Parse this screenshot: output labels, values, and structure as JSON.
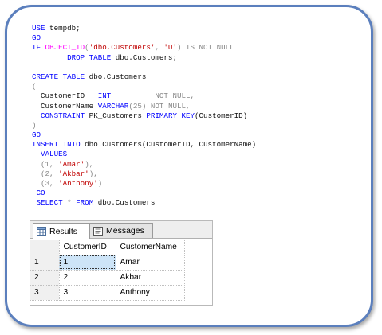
{
  "code": {
    "lines": [
      [
        {
          "t": "USE",
          "c": "kw"
        },
        {
          "t": " tempdb;",
          "c": ""
        }
      ],
      [
        {
          "t": "GO",
          "c": "kw"
        }
      ],
      [
        {
          "t": "IF",
          "c": "kw"
        },
        {
          "t": " ",
          "c": ""
        },
        {
          "t": "OBJECT_ID",
          "c": "fn"
        },
        {
          "t": "(",
          "c": "gray"
        },
        {
          "t": "'dbo.Customers'",
          "c": "str"
        },
        {
          "t": ", ",
          "c": "gray"
        },
        {
          "t": "'U'",
          "c": "str"
        },
        {
          "t": ") ",
          "c": "gray"
        },
        {
          "t": "IS NOT NULL",
          "c": "gray"
        }
      ],
      [
        {
          "t": "        DROP TABLE",
          "c": "kw"
        },
        {
          "t": " dbo.Customers;",
          "c": ""
        }
      ],
      [],
      [
        {
          "t": "CREATE TABLE",
          "c": "kw"
        },
        {
          "t": " dbo.Customers",
          "c": ""
        }
      ],
      [
        {
          "t": "(",
          "c": "gray"
        }
      ],
      [
        {
          "t": "  CustomerID   ",
          "c": ""
        },
        {
          "t": "INT",
          "c": "kw"
        },
        {
          "t": "          ",
          "c": ""
        },
        {
          "t": "NOT NULL,",
          "c": "gray"
        }
      ],
      [
        {
          "t": "  CustomerName ",
          "c": ""
        },
        {
          "t": "VARCHAR",
          "c": "kw"
        },
        {
          "t": "(25) ",
          "c": "gray"
        },
        {
          "t": "NOT NULL,",
          "c": "gray"
        }
      ],
      [
        {
          "t": "  ",
          "c": ""
        },
        {
          "t": "CONSTRAINT",
          "c": "kw"
        },
        {
          "t": " PK_Customers ",
          "c": ""
        },
        {
          "t": "PRIMARY KEY",
          "c": "kw"
        },
        {
          "t": "(CustomerID)",
          "c": ""
        }
      ],
      [
        {
          "t": ")",
          "c": "gray"
        }
      ],
      [
        {
          "t": "GO",
          "c": "kw"
        }
      ],
      [
        {
          "t": "INSERT INTO",
          "c": "kw"
        },
        {
          "t": " dbo.Customers(CustomerID, CustomerName)",
          "c": ""
        }
      ],
      [
        {
          "t": "  VALUES",
          "c": "kw"
        }
      ],
      [
        {
          "t": "  (1, ",
          "c": "gray"
        },
        {
          "t": "'Amar'",
          "c": "str"
        },
        {
          "t": "),",
          "c": "gray"
        }
      ],
      [
        {
          "t": "  (2, ",
          "c": "gray"
        },
        {
          "t": "'Akbar'",
          "c": "str"
        },
        {
          "t": "),",
          "c": "gray"
        }
      ],
      [
        {
          "t": "  (3, ",
          "c": "gray"
        },
        {
          "t": "'Anthony'",
          "c": "str"
        },
        {
          "t": ")",
          "c": "gray"
        }
      ],
      [
        {
          "t": " GO",
          "c": "kw"
        }
      ],
      [
        {
          "t": " SELECT",
          "c": "kw"
        },
        {
          "t": " * ",
          "c": "gray"
        },
        {
          "t": "FROM",
          "c": "kw"
        },
        {
          "t": " dbo.Customers",
          "c": ""
        }
      ]
    ]
  },
  "results": {
    "tabs": [
      {
        "label": "Results",
        "icon": "grid-icon",
        "active": true
      },
      {
        "label": "Messages",
        "icon": "messages-icon",
        "active": false
      }
    ],
    "columns": [
      "CustomerID",
      "CustomerName"
    ],
    "rows": [
      {
        "num": "1",
        "cells": [
          "1",
          "Amar"
        ]
      },
      {
        "num": "2",
        "cells": [
          "2",
          "Akbar"
        ]
      },
      {
        "num": "3",
        "cells": [
          "3",
          "Anthony"
        ]
      }
    ]
  },
  "colors": {
    "keyword": "#0000ff",
    "string": "#c00000",
    "function": "#ff00ff",
    "operator": "#888888",
    "frame_border": "#5b7fbd",
    "selected_cell": "#cde4f7"
  }
}
